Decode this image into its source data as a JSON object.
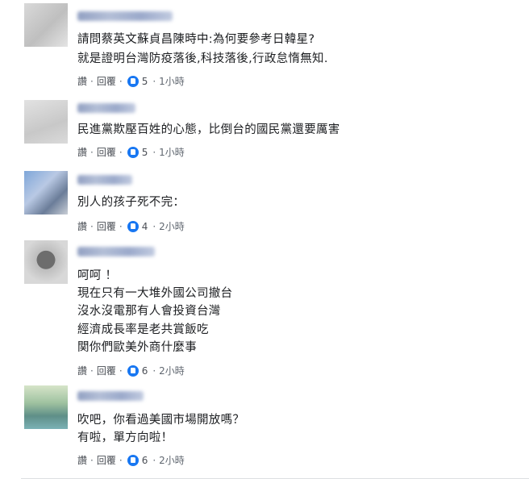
{
  "comments": [
    {
      "lines": [
        "請問蔡英文蘇貞昌陳時中:為何要參考日韓星?",
        "就是證明台灣防疫落後,科技落後,行政怠惰無知."
      ],
      "like": "讚",
      "reply": "回覆",
      "reactions": "5",
      "time": "1小時"
    },
    {
      "lines": [
        "民進黨欺壓百姓的心態，比倒台的國民黨還要厲害"
      ],
      "like": "讚",
      "reply": "回覆",
      "reactions": "5",
      "time": "1小時"
    },
    {
      "lines": [
        "別人的孩子死不完："
      ],
      "like": "讚",
      "reply": "回覆",
      "reactions": "4",
      "time": "2小時"
    },
    {
      "lines": [
        "呵呵 ！",
        "現在只有一大堆外國公司撤台",
        "沒水沒電那有人會投資台灣",
        "經濟成長率是老共賞飯吃",
        "関你們歐美外商什麼事"
      ],
      "like": "讚",
      "reply": "回覆",
      "reactions": "6",
      "time": "2小時"
    },
    {
      "lines": [
        "吹吧，你看過美國市場開放嗎？",
        "有啦，單方向啦！"
      ],
      "like": "讚",
      "reply": "回覆",
      "reactions": "6",
      "time": "2小時"
    }
  ],
  "colors": {
    "like_icon": "#1877f2",
    "meta_text": "#606770",
    "body_text": "#1c1e21"
  },
  "icons": {
    "reaction": "like-thumb-icon"
  }
}
